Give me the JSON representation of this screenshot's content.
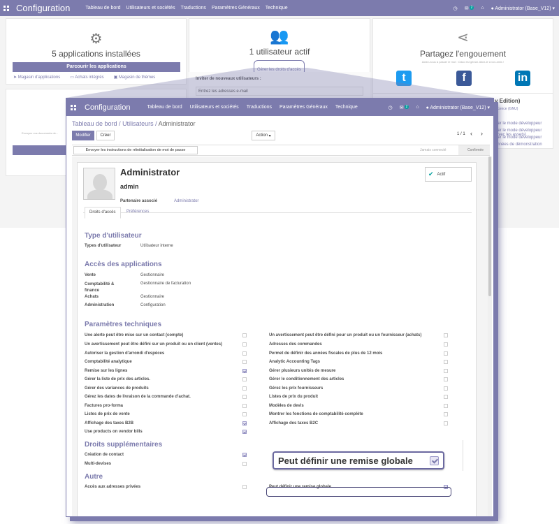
{
  "app_title": "Configuration",
  "nav": {
    "menu": [
      "Tableau de bord",
      "Utilisateurs et sociétés",
      "Traductions",
      "Paramètres Généraux",
      "Technique"
    ],
    "badge_count": "2",
    "user": "Administrator (Base_V12)"
  },
  "dashboard": {
    "apps": {
      "title": "5 applications installées",
      "button": "Parcourir les applications",
      "links": [
        "Magasin d'applications",
        "Achats intégrés",
        "Magasin de thèmes"
      ]
    },
    "users": {
      "title": "1 utilisateur actif",
      "button": "Gérer les droits d'accès",
      "invite_label": "Inviter de nouveaux utilisateurs :",
      "invite_placeholder": "Entrez les adresses e-mail"
    },
    "share": {
      "title": "Partagez l'engouement",
      "subtitle": "Aidez-nous à passer le mot : Odoo est génial. Allez-le à vos amis !",
      "socials": [
        "twitter-icon",
        "facebook-icon",
        "linkedin-icon"
      ]
    },
    "edition": {
      "title": "y Edition)",
      "license": "licence (GNU)",
      "dev_links": [
        "iver le mode développeur",
        "iver le mode développeur (avec les assets)",
        "iver le mode développeur",
        "onnées de démonstration"
      ]
    },
    "left_card_text": "Envoyez vos documents de..."
  },
  "breadcrumb": {
    "parent1": "Tableau de bord",
    "parent2": "Utilisateurs",
    "current": "Administrator"
  },
  "control": {
    "edit": "Modifier",
    "create": "Créer",
    "action": "Action",
    "pager": "1 / 1"
  },
  "statusbar": {
    "reset_button": "Envoyer les instructions de réinitialisation de mot de passe",
    "states": [
      "Jamais connecté",
      "Confirmée"
    ]
  },
  "user": {
    "name": "Administrator",
    "login": "admin",
    "partner_label": "Partenaire associé",
    "partner_value": "Administrator",
    "active_label": "Actif"
  },
  "tabs": [
    "Droits d'accès",
    "Préférences"
  ],
  "user_type": {
    "section": "Type d'utilisateur",
    "label": "Types d'utilisateur",
    "value": "Utilisateur interne"
  },
  "apps_access": {
    "section": "Accès des applications",
    "rows": [
      {
        "label": "Vente",
        "value": "Gestionnaire"
      },
      {
        "label": "Comptabilité & finance",
        "value": "Gestionnaire de facturation"
      },
      {
        "label": "Achats",
        "value": "Gestionnaire"
      },
      {
        "label": "Administration",
        "value": "Configuration"
      }
    ]
  },
  "tech": {
    "section": "Paramètres techniques",
    "left": [
      {
        "label": "Une alerte peut être mise sur un contact (compte)",
        "checked": false
      },
      {
        "label": "Un avertissement peut être défini sur un produit ou un client (ventes)",
        "checked": false
      },
      {
        "label": "Autoriser la gestion d'arrondi d'espèces",
        "checked": false
      },
      {
        "label": "Comptabilité analytique",
        "checked": false
      },
      {
        "label": "Remise sur les lignes",
        "checked": true
      },
      {
        "label": "Gérer la liste de prix des articles.",
        "checked": false
      },
      {
        "label": "Gérer des variances de produits",
        "checked": false
      },
      {
        "label": "Gérez les dates de livraison de la commande d'achat.",
        "checked": false
      },
      {
        "label": "Factures pro-forma",
        "checked": false
      },
      {
        "label": "Listes de prix de vente",
        "checked": false
      },
      {
        "label": "Affichage des taxes B2B",
        "checked": true
      },
      {
        "label": "Use products on vendor bills",
        "checked": true
      }
    ],
    "right": [
      {
        "label": "Un avertissement peut être défini pour un produit ou un fournisseur (achats)",
        "checked": false
      },
      {
        "label": "Adresses des commandes",
        "checked": false
      },
      {
        "label": "Permet de définir des années fiscales de plus de 12 mois",
        "checked": false
      },
      {
        "label": "Analytic Accounting Tags",
        "checked": false
      },
      {
        "label": "Gérer plusieurs unités de mesure",
        "checked": false
      },
      {
        "label": "Gérer le conditionnement des articles",
        "checked": false
      },
      {
        "label": "Gérez les prix fournisseurs",
        "checked": false
      },
      {
        "label": "Listes de prix du produit",
        "checked": false
      },
      {
        "label": "Modèles de devis",
        "checked": false
      },
      {
        "label": "Montrer les fonctions de comptabilité complète",
        "checked": false
      },
      {
        "label": "Affichage des taxes B2C",
        "checked": false
      }
    ]
  },
  "extra": {
    "section": "Droits supplémentaires",
    "rows": [
      {
        "label": "Création de contact",
        "checked": true
      },
      {
        "label": "Multi-devises",
        "checked": false
      }
    ]
  },
  "other": {
    "section": "Autre",
    "left": {
      "label": "Accès aux adresses privées",
      "checked": false
    },
    "right": {
      "label": "Peut définir une remise globale",
      "checked": true
    }
  },
  "zoom": {
    "label": "Peut définir une remise globale",
    "checked": true
  },
  "colors": {
    "brand": "#7c7bad",
    "active": "#00a09d"
  }
}
